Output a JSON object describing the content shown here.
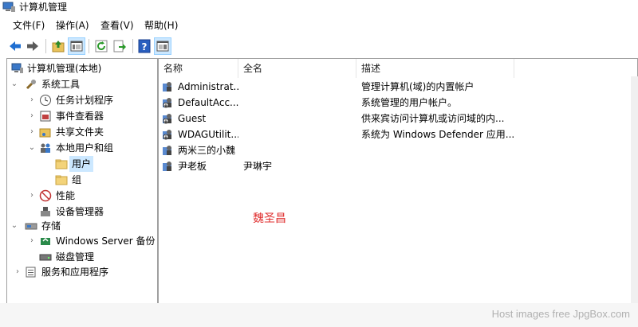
{
  "window": {
    "title": "计算机管理"
  },
  "menu": [
    "文件(F)",
    "操作(A)",
    "查看(V)",
    "帮助(H)"
  ],
  "tree": {
    "root": "计算机管理(本地)",
    "system_tools": "系统工具",
    "task_scheduler": "任务计划程序",
    "event_viewer": "事件查看器",
    "shared_folders": "共享文件夹",
    "local_users_groups": "本地用户和组",
    "users": "用户",
    "groups": "组",
    "performance": "性能",
    "device_manager": "设备管理器",
    "storage": "存储",
    "windows_server_backup": "Windows Server 备份",
    "disk_management": "磁盘管理",
    "services_apps": "服务和应用程序"
  },
  "list": {
    "columns": [
      "名称",
      "全名",
      "描述"
    ],
    "rows": [
      {
        "name": "Administrat...",
        "fullname": "",
        "desc": "管理计算机(域)的内置帐户"
      },
      {
        "name": "DefaultAcc...",
        "fullname": "",
        "desc": "系统管理的用户帐户。"
      },
      {
        "name": "Guest",
        "fullname": "",
        "desc": "供来宾访问计算机或访问域的内..."
      },
      {
        "name": "WDAGUtilit...",
        "fullname": "",
        "desc": "系统为 Windows Defender 应用..."
      },
      {
        "name": "两米三的小魏",
        "fullname": "",
        "desc": ""
      },
      {
        "name": "尹老板",
        "fullname": "尹琳宇",
        "desc": ""
      }
    ]
  },
  "annotation": "魏圣昌",
  "footer": {
    "host_text": "Host images free JpgBox.com"
  },
  "colors": {
    "selection": "#cce8ff",
    "annotation": "#e03030",
    "nav_arrow_blue": "#1f6fd1"
  }
}
